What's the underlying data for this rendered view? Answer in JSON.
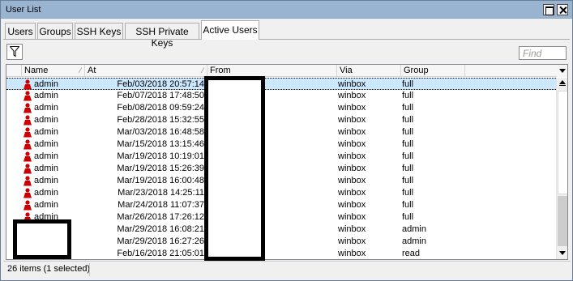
{
  "window": {
    "title": "User List"
  },
  "tabs": [
    {
      "label": "Users",
      "active": false
    },
    {
      "label": "Groups",
      "active": false
    },
    {
      "label": "SSH Keys",
      "active": false
    },
    {
      "label": "SSH Private Keys",
      "active": false
    },
    {
      "label": "Active Users",
      "active": true
    }
  ],
  "toolbar": {
    "filter_icon": "filter-funnel-icon",
    "find_placeholder": "Find"
  },
  "table": {
    "columns": [
      "Name",
      "At",
      "From",
      "Via",
      "Group"
    ],
    "rows": [
      {
        "name": "admin",
        "at": "Feb/03/2018 20:57:14",
        "from": "",
        "via": "winbox",
        "group": "full",
        "selected": true
      },
      {
        "name": "admin",
        "at": "Feb/07/2018 17:48:50",
        "from": "",
        "via": "winbox",
        "group": "full"
      },
      {
        "name": "admin",
        "at": "Feb/08/2018 09:59:24",
        "from": "",
        "via": "winbox",
        "group": "full"
      },
      {
        "name": "admin",
        "at": "Feb/28/2018 15:32:55",
        "from": "",
        "via": "winbox",
        "group": "full"
      },
      {
        "name": "admin",
        "at": "Mar/03/2018 16:48:58",
        "from": "",
        "via": "winbox",
        "group": "full"
      },
      {
        "name": "admin",
        "at": "Mar/15/2018 13:15:46",
        "from": "",
        "via": "winbox",
        "group": "full"
      },
      {
        "name": "admin",
        "at": "Mar/19/2018 10:19:01",
        "from": "",
        "via": "winbox",
        "group": "full"
      },
      {
        "name": "admin",
        "at": "Mar/19/2018 15:26:39",
        "from": "",
        "via": "winbox",
        "group": "full"
      },
      {
        "name": "admin",
        "at": "Mar/19/2018 16:00:48",
        "from": "",
        "via": "winbox",
        "group": "full"
      },
      {
        "name": "admin",
        "at": "Mar/23/2018 14:25:11",
        "from": "",
        "via": "winbox",
        "group": "full"
      },
      {
        "name": "admin",
        "at": "Mar/24/2018 11:07:37",
        "from": "",
        "via": "winbox",
        "group": "full"
      },
      {
        "name": "admin",
        "at": "Mar/26/2018 17:26:12",
        "from": "",
        "via": "winbox",
        "group": "full"
      },
      {
        "name": "",
        "at": "Mar/29/2018 16:08:21",
        "from": "",
        "via": "winbox",
        "group": "admin"
      },
      {
        "name": "",
        "at": "Mar/29/2018 16:27:26",
        "from": "",
        "via": "winbox",
        "group": "admin"
      },
      {
        "name": "",
        "at": "Feb/16/2018 21:05:01",
        "from": "",
        "via": "winbox",
        "group": "read"
      }
    ]
  },
  "status": {
    "text": "26 items (1 selected)"
  },
  "colors": {
    "titlebar": "#99b4d1",
    "selected_row": "#cce8ff",
    "user_icon": "#cc0000"
  }
}
